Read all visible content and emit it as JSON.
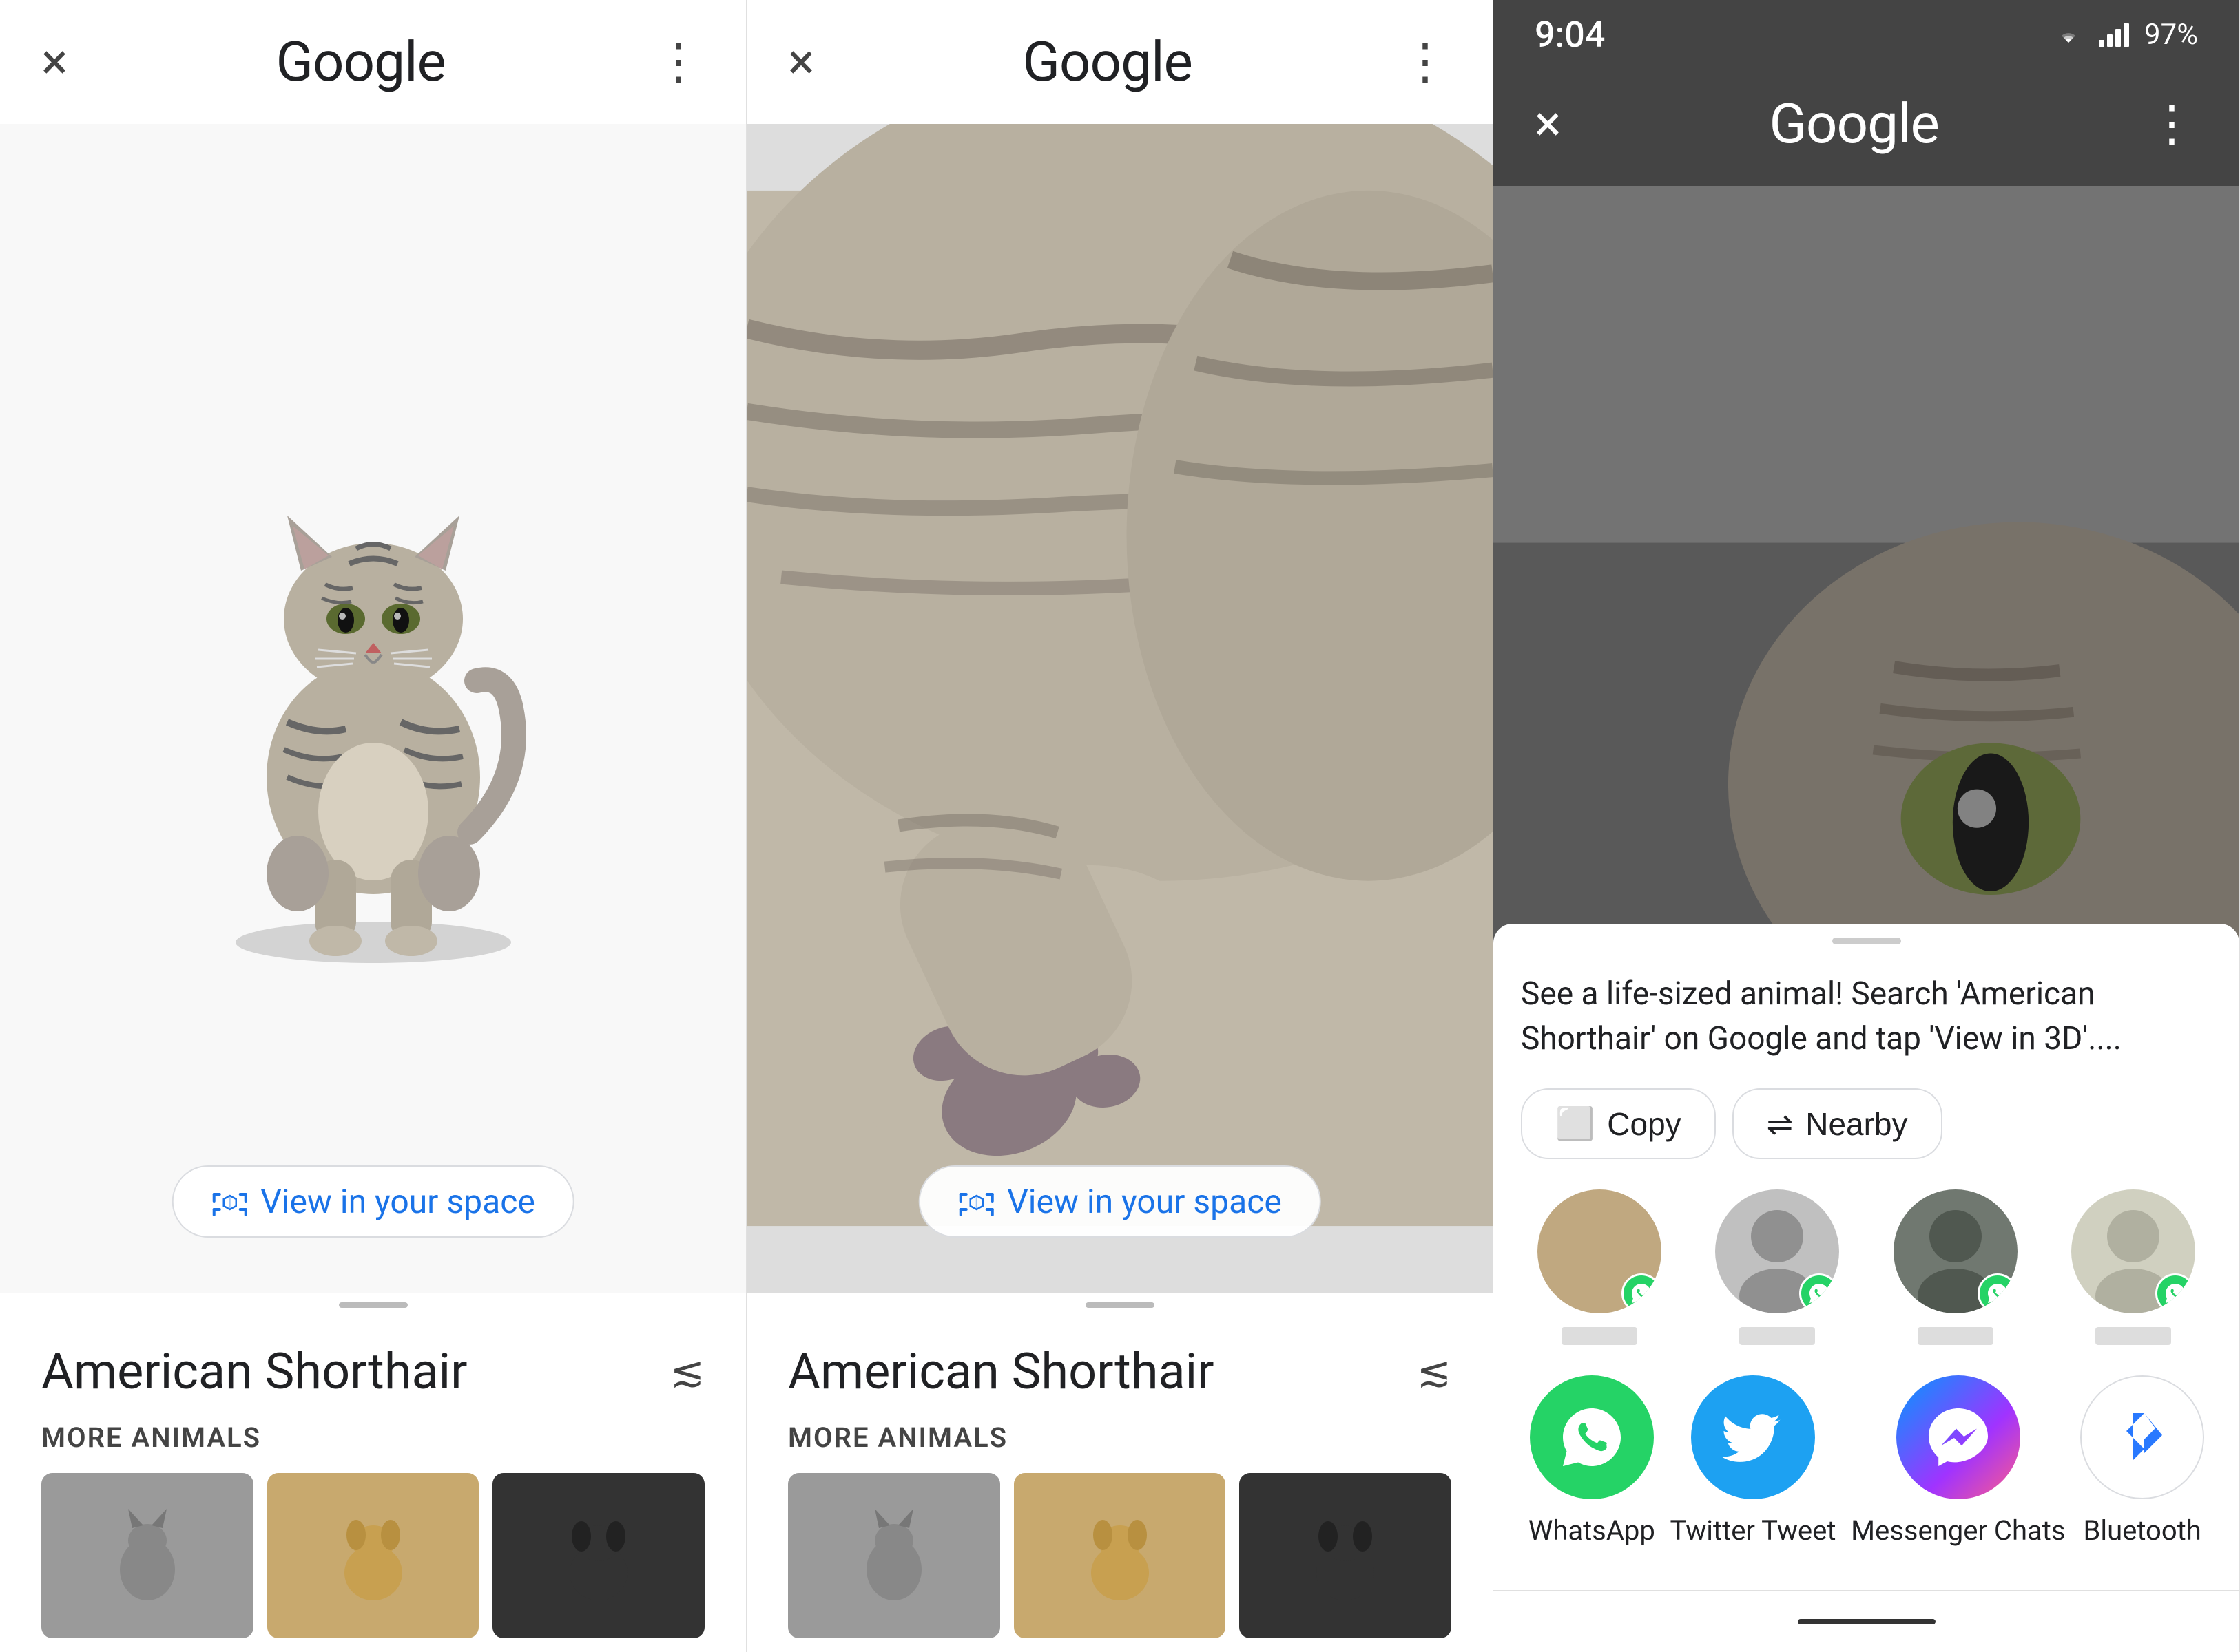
{
  "panels": [
    {
      "id": "panel1",
      "topBar": {
        "closeLabel": "×",
        "googleLabel": "Google",
        "moreLabel": "⋮"
      },
      "viewerBg": "#f8f8f8",
      "viewInSpaceLabel": "View in your space",
      "animalName": "American Shorthair",
      "moreAnimalsLabel": "MORE ANIMALS",
      "thumbs": [
        "gray-cat",
        "golden-dog",
        "black-dog"
      ]
    },
    {
      "id": "panel2",
      "topBar": {
        "closeLabel": "×",
        "googleLabel": "Google",
        "moreLabel": "⋮"
      },
      "viewerBg": "#f8f8f8",
      "viewInSpaceLabel": "View in your space",
      "animalName": "American Shorthair",
      "moreAnimalsLabel": "MORE ANIMALS",
      "thumbs": [
        "gray-cat",
        "golden-dog",
        "black-dog"
      ]
    },
    {
      "id": "panel3",
      "statusBar": {
        "time": "9:04",
        "batteryPct": "97%"
      },
      "topBar": {
        "closeLabel": "×",
        "googleLabel": "Google",
        "moreLabel": "⋮"
      },
      "shareSheet": {
        "description": "See a life-sized animal! Search 'American Shorthair' on Google and tap 'View in 3D'....",
        "copyLabel": "Copy",
        "nearbyLabel": "Nearby",
        "apps": [
          {
            "id": "whatsapp",
            "label": "WhatsApp",
            "icon": "💬"
          },
          {
            "id": "twitter",
            "label": "Twitter Tweet",
            "icon": "🐦"
          },
          {
            "id": "messenger",
            "label": "Messenger Chats",
            "icon": "✈"
          },
          {
            "id": "bluetooth",
            "label": "Bluetooth",
            "icon": "✦"
          }
        ],
        "contacts": [
          {
            "id": "contact1",
            "name": ""
          },
          {
            "id": "contact2",
            "name": ""
          },
          {
            "id": "contact3",
            "name": ""
          },
          {
            "id": "contact4",
            "name": ""
          }
        ]
      }
    }
  ]
}
